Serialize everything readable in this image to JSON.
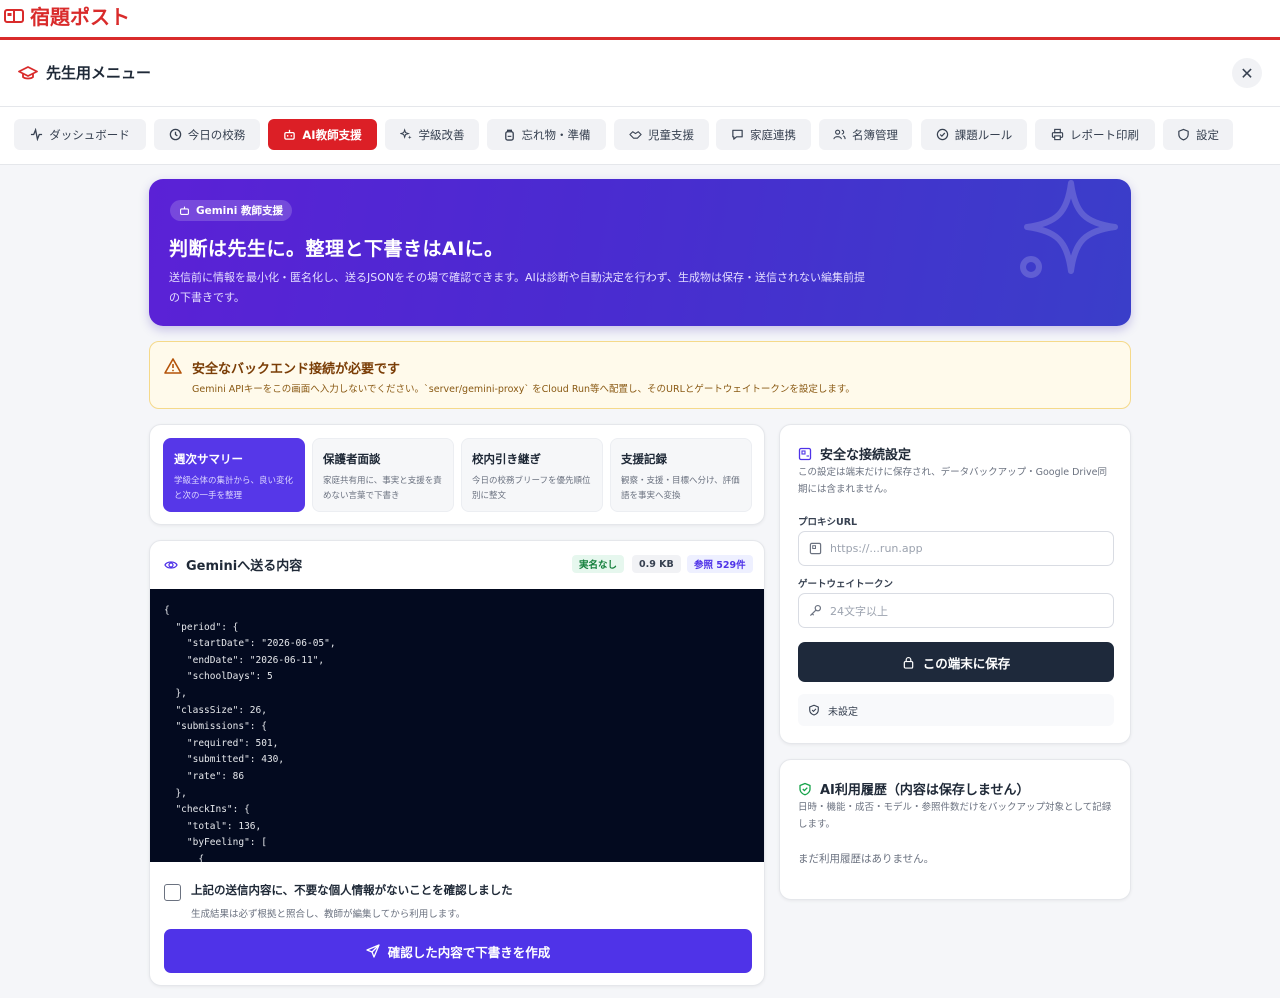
{
  "app": {
    "brand": "宿題ポスト"
  },
  "menu": {
    "title": "先生用メニュー",
    "close": "✕"
  },
  "tabs": [
    {
      "label": "ダッシュボード",
      "icon": "activity-icon"
    },
    {
      "label": "今日の校務",
      "icon": "clock-icon"
    },
    {
      "label": "AI教師支援",
      "icon": "robot-icon",
      "active": true
    },
    {
      "label": "学級改善",
      "icon": "sparkles-icon"
    },
    {
      "label": "忘れ物・準備",
      "icon": "backpack-icon"
    },
    {
      "label": "児童支援",
      "icon": "handshake-icon"
    },
    {
      "label": "家庭連携",
      "icon": "message-icon"
    },
    {
      "label": "名簿管理",
      "icon": "users-icon"
    },
    {
      "label": "課題ルール",
      "icon": "check-circle-icon"
    },
    {
      "label": "レポート印刷",
      "icon": "printer-icon"
    },
    {
      "label": "設定",
      "icon": "shield-icon"
    }
  ],
  "hero": {
    "badge": "Gemini 教師支援",
    "title": "判断は先生に。整理と下書きはAIに。",
    "desc": "送信前に情報を最小化・匿名化し、送るJSONをその場で確認できます。AIは診断や自動決定を行わず、生成物は保存・送信されない編集前提の下書きです。"
  },
  "warning": {
    "title": "安全なバックエンド接続が必要です",
    "desc": "Gemini APIキーをこの画面へ入力しないでください。`server/gemini-proxy` をCloud Run等へ配置し、そのURLとゲートウェイトークンを設定します。"
  },
  "modes": [
    {
      "title": "週次サマリー",
      "desc": "学級全体の集計から、良い変化と次の一手を整理",
      "active": true
    },
    {
      "title": "保護者面談",
      "desc": "家庭共有用に、事実と支援を責めない言葉で下書き"
    },
    {
      "title": "校内引き継ぎ",
      "desc": "今日の校務ブリーフを優先順位別に整文"
    },
    {
      "title": "支援記録",
      "desc": "観察・支援・目標へ分け、評価語を事実へ変換"
    }
  ],
  "gemini": {
    "title": "Geminiへ送る内容",
    "pills": {
      "names": "実名なし",
      "size": "0.9 KB",
      "refs": "参照 529件"
    },
    "json": "{\n  \"period\": {\n    \"startDate\": \"2026-06-05\",\n    \"endDate\": \"2026-06-11\",\n    \"schoolDays\": 5\n  },\n  \"classSize\": 26,\n  \"submissions\": {\n    \"required\": 501,\n    \"submitted\": 430,\n    \"rate\": 86\n  },\n  \"checkIns\": {\n    \"total\": 136,\n    \"byFeeling\": [\n      {",
    "confirm_title": "上記の送信内容に、不要な個人情報がないことを確認しました",
    "confirm_desc": "生成結果は必ず根拠と照合し、教師が編集してから利用します。",
    "submit": "確認した内容で下書きを作成"
  },
  "connection": {
    "title": "安全な接続設定",
    "desc": "この設定は端末だけに保存され、データバックアップ・Google Drive同期には含まれません。",
    "proxy_label": "プロキシURL",
    "proxy_placeholder": "https://...run.app",
    "token_label": "ゲートウェイトークン",
    "token_placeholder": "24文字以上",
    "save": "この端末に保存",
    "status": "未設定"
  },
  "history": {
    "title": "AI利用履歴（内容は保存しません）",
    "desc": "日時・機能・成否・モデル・参照件数だけをバックアップ対象として記録します。",
    "empty": "まだ利用履歴はありません。"
  },
  "colors": {
    "brand": "#d92b2b",
    "accent": "#4f33e8",
    "hero_start": "#5b21d6",
    "hero_end": "#3a3ec9"
  }
}
